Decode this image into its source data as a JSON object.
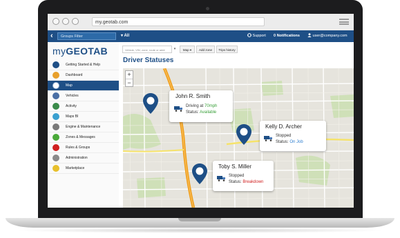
{
  "browser": {
    "url": "my.geotab.com"
  },
  "topnav": {
    "groups_filter": "Groups Filter",
    "all_label": "All",
    "support_label": "Support",
    "notifications_label": "0 Notifications",
    "user_email": "user@company.com"
  },
  "sidebar": {
    "logo_prefix": "my",
    "logo_main": "GEOTAB",
    "items": [
      {
        "label": "Getting Started & Help",
        "icon": "help-icon",
        "color": "#1e4f86"
      },
      {
        "label": "Dashboard",
        "icon": "dashboard-icon",
        "color": "#e8a02c"
      },
      {
        "label": "Map",
        "icon": "map-icon",
        "color": "#ffffff"
      },
      {
        "label": "Vehicles",
        "icon": "truck-icon",
        "color": "#4a6fa5"
      },
      {
        "label": "Activity",
        "icon": "activity-icon",
        "color": "#3a8b4a"
      },
      {
        "label": "Maps BI",
        "icon": "maps-bi-icon",
        "color": "#3aa0d0"
      },
      {
        "label": "Engine & Maintenance",
        "icon": "engine-icon",
        "color": "#7a7a7a"
      },
      {
        "label": "Zones & Messages",
        "icon": "zones-icon",
        "color": "#4aaa3a"
      },
      {
        "label": "Rules & Groups",
        "icon": "rules-icon",
        "color": "#d02020"
      },
      {
        "label": "Administration",
        "icon": "gear-icon",
        "color": "#8a8a8a"
      },
      {
        "label": "Marketplace",
        "icon": "marketplace-icon",
        "color": "#e8c02c"
      }
    ],
    "active_index": 2
  },
  "toolbar": {
    "search_placeholder": "Vehicle, VIN, zone, route or addr",
    "map_button": "Map",
    "add_zone_button": "Add zone",
    "trips_history_button": "Trips history"
  },
  "page": {
    "title": "Driver Statuses"
  },
  "drivers": [
    {
      "name": "John R. Smith",
      "status_prefix": "Driving at ",
      "status_value": "70mph",
      "status_label": "Status: ",
      "status_text": "Available",
      "status_color": "#3aa03a"
    },
    {
      "name": "Kelly D. Archer",
      "status_line": "Stopped",
      "status_label": "Status: ",
      "status_text": "On Job",
      "status_color": "#2f7fd0"
    },
    {
      "name": "Toby S. Miller",
      "status_line": "Stopped",
      "status_label": "Status: ",
      "status_text": "Breakdown",
      "status_color": "#d02020"
    }
  ],
  "colors": {
    "brand": "#1e4f86",
    "pin": "#1e4f86",
    "highway": "#f0a020"
  }
}
